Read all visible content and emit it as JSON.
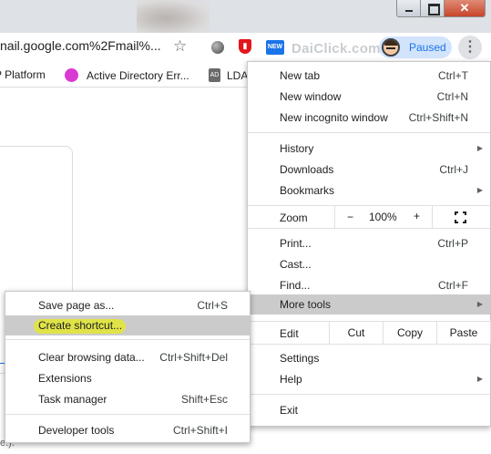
{
  "window": {
    "controls": [
      "minimize",
      "maximize",
      "close"
    ]
  },
  "toolbar": {
    "url": "nail.google.com%2Fmail%...",
    "daiclick_logo": "DaiClick.com",
    "ext_new_badge": "NEW",
    "profile_status": "Paused",
    "menu_glyph": "⋮"
  },
  "bookmarks": [
    {
      "label": "P Platform"
    },
    {
      "label": "Active Directory Err..."
    },
    {
      "label": "LDA"
    }
  ],
  "page": {
    "footer_text": "e.)."
  },
  "menu": {
    "new_tab": {
      "label": "New tab",
      "shortcut": "Ctrl+T"
    },
    "new_window": {
      "label": "New window",
      "shortcut": "Ctrl+N"
    },
    "new_incognito": {
      "label": "New incognito window",
      "shortcut": "Ctrl+Shift+N"
    },
    "history": {
      "label": "History"
    },
    "downloads": {
      "label": "Downloads",
      "shortcut": "Ctrl+J"
    },
    "bookmarks": {
      "label": "Bookmarks"
    },
    "zoom": {
      "label": "Zoom",
      "minus": "−",
      "value": "100%",
      "plus": "+"
    },
    "print": {
      "label": "Print...",
      "shortcut": "Ctrl+P"
    },
    "cast": {
      "label": "Cast..."
    },
    "find": {
      "label": "Find...",
      "shortcut": "Ctrl+F"
    },
    "more_tools": {
      "label": "More tools"
    },
    "edit": {
      "label": "Edit",
      "cut": "Cut",
      "copy": "Copy",
      "paste": "Paste"
    },
    "settings": {
      "label": "Settings"
    },
    "help": {
      "label": "Help"
    },
    "exit": {
      "label": "Exit"
    }
  },
  "submenu": {
    "save_page": {
      "label": "Save page as...",
      "shortcut": "Ctrl+S"
    },
    "create_shortcut": {
      "label": "Create shortcut..."
    },
    "clear_browsing": {
      "label": "Clear browsing data...",
      "shortcut": "Ctrl+Shift+Del"
    },
    "extensions": {
      "label": "Extensions"
    },
    "task_manager": {
      "label": "Task manager",
      "shortcut": "Shift+Esc"
    },
    "developer_tools": {
      "label": "Developer tools",
      "shortcut": "Ctrl+Shift+I"
    }
  },
  "colors": {
    "highlight_marker": "#ebf000",
    "hover_row": "#cbcbcb",
    "profile_bg": "#d2e3fc",
    "close_button": "#c7462b"
  }
}
